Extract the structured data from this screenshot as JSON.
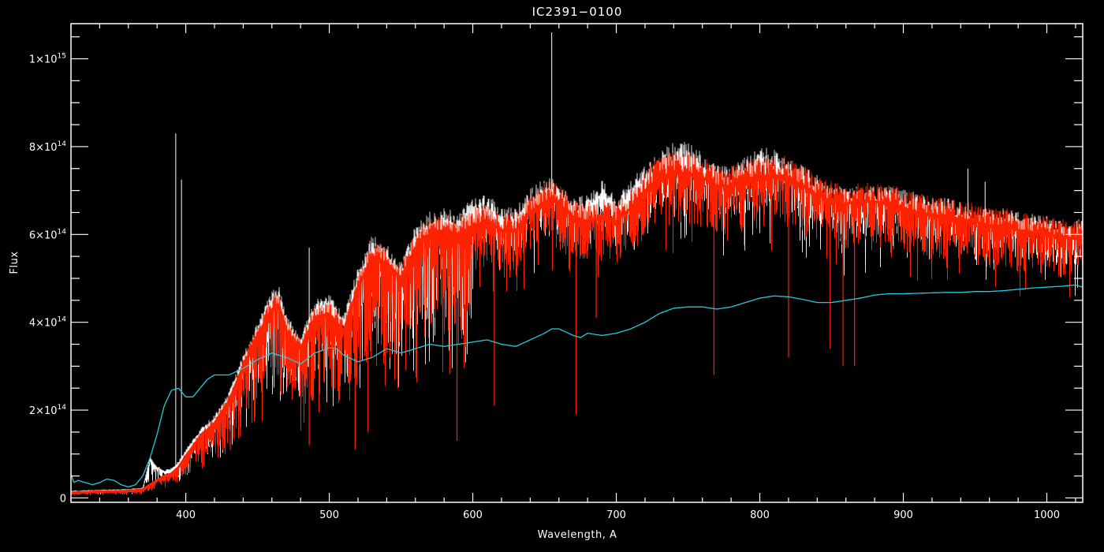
{
  "chart_data": {
    "type": "line",
    "title": "IC2391−0100",
    "xlabel": "Wavelength, A",
    "ylabel": "Flux",
    "xlim": [
      320,
      1025
    ],
    "ylim": [
      -10000000000000.0,
      1080000000000000.0
    ],
    "grid": false,
    "background": "#000000",
    "axis_color": "#ffffff",
    "x_ticks": [
      400,
      500,
      600,
      700,
      800,
      900,
      1000
    ],
    "x_tick_labels": [
      "400",
      "500",
      "600",
      "700",
      "800",
      "900",
      "1000"
    ],
    "y_ticks": [
      0,
      200000000000000.0,
      400000000000000.0,
      600000000000000.0,
      800000000000000.0,
      1000000000000000.0
    ],
    "y_tick_labels": [
      {
        "mantissa": "0",
        "exp": ""
      },
      {
        "mantissa": "2×10",
        "exp": "14"
      },
      {
        "mantissa": "4×10",
        "exp": "14"
      },
      {
        "mantissa": "6×10",
        "exp": "14"
      },
      {
        "mantissa": "8×10",
        "exp": "14"
      },
      {
        "mantissa": "1×10",
        "exp": "15"
      }
    ],
    "series": [
      {
        "color": "#ffffff",
        "style": "observed",
        "x": [
          320,
          330,
          340,
          350,
          360,
          370,
          375,
          380,
          385,
          390,
          395,
          400,
          410,
          420,
          430,
          440,
          450,
          460,
          465,
          470,
          480,
          490,
          500,
          510,
          520,
          530,
          540,
          550,
          560,
          570,
          580,
          590,
          600,
          610,
          620,
          630,
          640,
          650,
          655,
          660,
          670,
          680,
          690,
          700,
          710,
          720,
          730,
          740,
          750,
          760,
          770,
          780,
          790,
          800,
          810,
          820,
          830,
          840,
          850,
          860,
          870,
          880,
          890,
          900,
          910,
          920,
          930,
          940,
          950,
          960,
          970,
          980,
          990,
          1000,
          1010,
          1020,
          1025
        ],
        "y": [
          15000000000000.0,
          16000000000000.0,
          18000000000000.0,
          18000000000000.0,
          19000000000000.0,
          22000000000000.0,
          90000000000000.0,
          70000000000000.0,
          60000000000000.0,
          65000000000000.0,
          80000000000000.0,
          105000000000000.0,
          150000000000000.0,
          180000000000000.0,
          230000000000000.0,
          310000000000000.0,
          380000000000000.0,
          450000000000000.0,
          460000000000000.0,
          400000000000000.0,
          350000000000000.0,
          430000000000000.0,
          440000000000000.0,
          400000000000000.0,
          500000000000000.0,
          570000000000000.0,
          550000000000000.0,
          510000000000000.0,
          590000000000000.0,
          620000000000000.0,
          630000000000000.0,
          620000000000000.0,
          650000000000000.0,
          660000000000000.0,
          630000000000000.0,
          630000000000000.0,
          670000000000000.0,
          695000000000000.0,
          700000000000000.0,
          680000000000000.0,
          650000000000000.0,
          660000000000000.0,
          690000000000000.0,
          650000000000000.0,
          690000000000000.0,
          720000000000000.0,
          750000000000000.0,
          770000000000000.0,
          770000000000000.0,
          750000000000000.0,
          720000000000000.0,
          720000000000000.0,
          740000000000000.0,
          760000000000000.0,
          755000000000000.0,
          740000000000000.0,
          720000000000000.0,
          700000000000000.0,
          680000000000000.0,
          670000000000000.0,
          675000000000000.0,
          680000000000000.0,
          675000000000000.0,
          670000000000000.0,
          660000000000000.0,
          650000000000000.0,
          650000000000000.0,
          640000000000000.0,
          630000000000000.0,
          625000000000000.0,
          630000000000000.0,
          620000000000000.0,
          615000000000000.0,
          610000000000000.0,
          600000000000000.0,
          600000000000000.0,
          610000000000000.0
        ]
      },
      {
        "color": "#ff2200",
        "style": "model",
        "x": [
          320,
          330,
          340,
          350,
          360,
          370,
          375,
          380,
          385,
          390,
          395,
          400,
          410,
          420,
          430,
          440,
          450,
          460,
          465,
          470,
          480,
          490,
          500,
          510,
          520,
          530,
          540,
          550,
          560,
          570,
          580,
          590,
          600,
          610,
          620,
          630,
          640,
          650,
          655,
          660,
          670,
          680,
          690,
          700,
          710,
          720,
          730,
          740,
          750,
          760,
          770,
          780,
          790,
          800,
          810,
          820,
          830,
          840,
          850,
          860,
          870,
          880,
          890,
          900,
          910,
          920,
          930,
          940,
          950,
          960,
          970,
          980,
          990,
          1000,
          1010,
          1020,
          1025
        ],
        "y": [
          12000000000000.0,
          13000000000000.0,
          15000000000000.0,
          15000000000000.0,
          16000000000000.0,
          19000000000000.0,
          30000000000000.0,
          40000000000000.0,
          50000000000000.0,
          55000000000000.0,
          70000000000000.0,
          95000000000000.0,
          140000000000000.0,
          170000000000000.0,
          220000000000000.0,
          300000000000000.0,
          370000000000000.0,
          430000000000000.0,
          440000000000000.0,
          380000000000000.0,
          340000000000000.0,
          410000000000000.0,
          420000000000000.0,
          380000000000000.0,
          480000000000000.0,
          550000000000000.0,
          535000000000000.0,
          500000000000000.0,
          570000000000000.0,
          600000000000000.0,
          610000000000000.0,
          600000000000000.0,
          620000000000000.0,
          630000000000000.0,
          610000000000000.0,
          610000000000000.0,
          650000000000000.0,
          675000000000000.0,
          680000000000000.0,
          670000000000000.0,
          640000000000000.0,
          630000000000000.0,
          640000000000000.0,
          630000000000000.0,
          660000000000000.0,
          700000000000000.0,
          730000000000000.0,
          740000000000000.0,
          740000000000000.0,
          730000000000000.0,
          710000000000000.0,
          710000000000000.0,
          720000000000000.0,
          730000000000000.0,
          735000000000000.0,
          730000000000000.0,
          710000000000000.0,
          690000000000000.0,
          675000000000000.0,
          670000000000000.0,
          675000000000000.0,
          675000000000000.0,
          670000000000000.0,
          660000000000000.0,
          650000000000000.0,
          645000000000000.0,
          640000000000000.0,
          635000000000000.0,
          630000000000000.0,
          620000000000000.0,
          620000000000000.0,
          610000000000000.0,
          605000000000000.0,
          600000000000000.0,
          595000000000000.0,
          590000000000000.0,
          595000000000000.0
        ]
      },
      {
        "color": "#22ccdd",
        "style": "smooth",
        "x": [
          320,
          322,
          325,
          330,
          335,
          340,
          345,
          350,
          355,
          360,
          365,
          370,
          375,
          380,
          385,
          390,
          395,
          400,
          405,
          410,
          415,
          420,
          430,
          440,
          450,
          460,
          470,
          480,
          490,
          500,
          505,
          510,
          520,
          530,
          540,
          550,
          560,
          570,
          580,
          590,
          600,
          610,
          620,
          630,
          640,
          650,
          655,
          660,
          670,
          675,
          680,
          690,
          700,
          710,
          720,
          730,
          740,
          750,
          760,
          770,
          780,
          790,
          800,
          810,
          820,
          830,
          840,
          850,
          860,
          870,
          880,
          890,
          900,
          910,
          920,
          930,
          940,
          950,
          960,
          970,
          980,
          990,
          1000,
          1010,
          1020,
          1025
        ],
        "y": [
          55000000000000.0,
          35000000000000.0,
          40000000000000.0,
          35000000000000.0,
          30000000000000.0,
          35000000000000.0,
          43000000000000.0,
          40000000000000.0,
          30000000000000.0,
          25000000000000.0,
          30000000000000.0,
          50000000000000.0,
          90000000000000.0,
          145000000000000.0,
          210000000000000.0,
          245000000000000.0,
          250000000000000.0,
          230000000000000.0,
          230000000000000.0,
          250000000000000.0,
          270000000000000.0,
          280000000000000.0,
          280000000000000.0,
          295000000000000.0,
          315000000000000.0,
          330000000000000.0,
          320000000000000.0,
          305000000000000.0,
          330000000000000.0,
          342000000000000.0,
          340000000000000.0,
          325000000000000.0,
          310000000000000.0,
          320000000000000.0,
          340000000000000.0,
          330000000000000.0,
          340000000000000.0,
          350000000000000.0,
          345000000000000.0,
          350000000000000.0,
          355000000000000.0,
          360000000000000.0,
          350000000000000.0,
          345000000000000.0,
          360000000000000.0,
          375000000000000.0,
          385000000000000.0,
          385000000000000.0,
          370000000000000.0,
          365000000000000.0,
          375000000000000.0,
          370000000000000.0,
          375000000000000.0,
          385000000000000.0,
          400000000000000.0,
          420000000000000.0,
          432000000000000.0,
          435000000000000.0,
          435000000000000.0,
          430000000000000.0,
          435000000000000.0,
          445000000000000.0,
          455000000000000.0,
          460000000000000.0,
          458000000000000.0,
          452000000000000.0,
          445000000000000.0,
          445000000000000.0,
          450000000000000.0,
          455000000000000.0,
          462000000000000.0,
          465000000000000.0,
          465000000000000.0,
          466000000000000.0,
          467000000000000.0,
          468000000000000.0,
          468000000000000.0,
          470000000000000.0,
          470000000000000.0,
          472000000000000.0,
          475000000000000.0,
          478000000000000.0,
          480000000000000.0,
          482000000000000.0,
          485000000000000.0,
          480000000000000.0
        ]
      }
    ],
    "absorption_lines": [
      {
        "x": 589,
        "y_min": 130000000000000.0
      },
      {
        "x": 672,
        "y_min": 190000000000000.0
      },
      {
        "x": 615,
        "y_min": 210000000000000.0
      },
      {
        "x": 768,
        "y_min": 280000000000000.0
      },
      {
        "x": 820,
        "y_min": 320000000000000.0
      },
      {
        "x": 858,
        "y_min": 300000000000000.0
      },
      {
        "x": 866,
        "y_min": 300000000000000.0
      },
      {
        "x": 849,
        "y_min": 340000000000000.0
      },
      {
        "x": 686,
        "y_min": 410000000000000.0
      },
      {
        "x": 518,
        "y_min": 110000000000000.0
      },
      {
        "x": 527,
        "y_min": 150000000000000.0
      },
      {
        "x": 486,
        "y_min": 120000000000000.0
      },
      {
        "x": 438,
        "y_min": 140000000000000.0
      },
      {
        "x": 431,
        "y_min": 110000000000000.0
      }
    ],
    "emission_spikes": [
      {
        "x": 655,
        "y_max": 1060000000000000.0
      },
      {
        "x": 393,
        "y_max": 830000000000000.0
      },
      {
        "x": 397,
        "y_max": 725000000000000.0
      },
      {
        "x": 486,
        "y_max": 570000000000000.0
      },
      {
        "x": 945,
        "y_max": 750000000000000.0
      },
      {
        "x": 957,
        "y_max": 720000000000000.0
      }
    ]
  }
}
